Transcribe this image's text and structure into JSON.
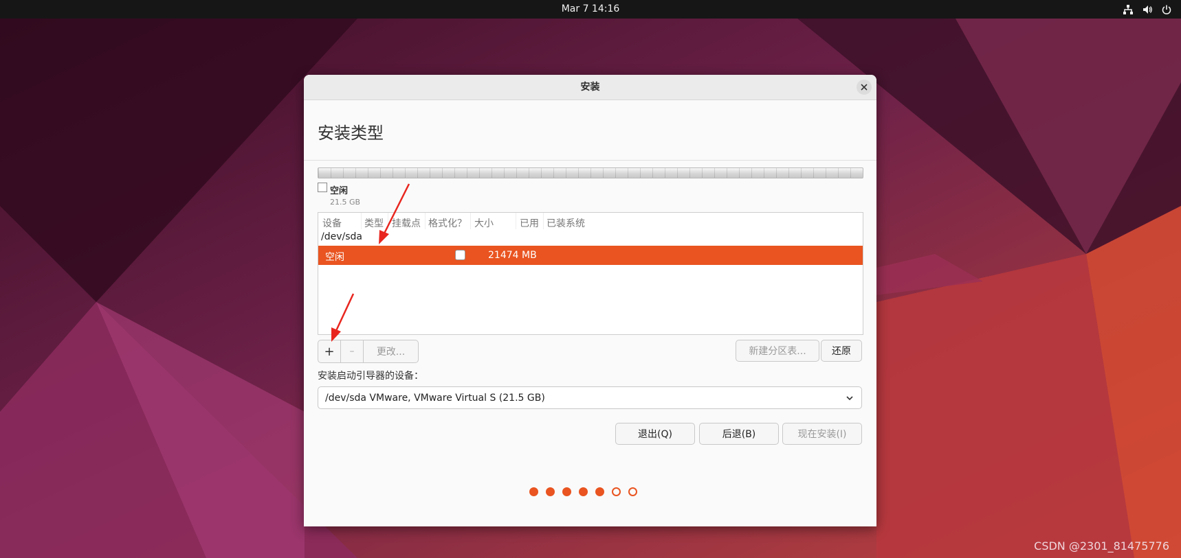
{
  "topbar": {
    "datetime": "Mar 7  14:16",
    "icons": [
      "network-icon",
      "volume-icon",
      "power-icon"
    ]
  },
  "window": {
    "title": "安装",
    "page_title": "安装类型",
    "legend": {
      "label": "空闲",
      "size": "21.5 GB"
    },
    "table": {
      "columns": [
        "设备",
        "类型",
        "挂载点",
        "格式化？",
        "大小",
        "已用",
        "已装系统"
      ],
      "device": "/dev/sda",
      "selected_row": {
        "name": "空闲",
        "format_checked": false,
        "size": "21474 MB"
      }
    },
    "toolbar": {
      "add": "+",
      "remove": "–",
      "change": "更改...",
      "new_table": "新建分区表...",
      "revert": "还原"
    },
    "boot": {
      "label": "安装启动引导器的设备：",
      "value": "/dev/sda VMware, VMware Virtual S (21.5 GB)"
    },
    "buttons": {
      "quit": "退出(Q)",
      "back": "后退(B)",
      "install": "现在安装(I)"
    },
    "progress": {
      "total": 7,
      "completed": 5
    }
  },
  "colors": {
    "accent": "#e95420",
    "topbar": "#161616"
  },
  "watermark": "CSDN @2301_81475776"
}
